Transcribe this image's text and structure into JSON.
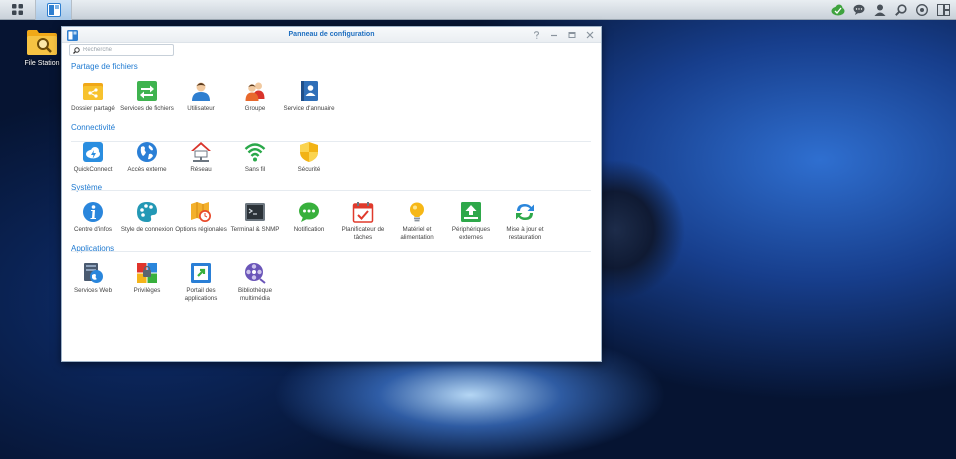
{
  "desktop": {
    "shortcut_label": "File Station"
  },
  "window": {
    "title": "Panneau de configuration",
    "search_placeholder": "Recherche"
  },
  "sections": [
    {
      "title": "Partage de fichiers",
      "items": [
        {
          "label": "Dossier partagé",
          "icon": "shared-folder-icon"
        },
        {
          "label": "Services de fichiers",
          "icon": "file-services-icon"
        },
        {
          "label": "Utilisateur",
          "icon": "user-icon"
        },
        {
          "label": "Groupe",
          "icon": "group-icon"
        },
        {
          "label": "Service d'annuaire",
          "icon": "directory-service-icon"
        }
      ]
    },
    {
      "title": "Connectivité",
      "items": [
        {
          "label": "QuickConnect",
          "icon": "quickconnect-icon"
        },
        {
          "label": "Accès externe",
          "icon": "external-access-icon"
        },
        {
          "label": "Réseau",
          "icon": "network-icon"
        },
        {
          "label": "Sans fil",
          "icon": "wireless-icon"
        },
        {
          "label": "Sécurité",
          "icon": "security-icon"
        }
      ]
    },
    {
      "title": "Système",
      "items": [
        {
          "label": "Centre d'infos",
          "icon": "info-center-icon"
        },
        {
          "label": "Style de connexion",
          "icon": "login-style-icon"
        },
        {
          "label": "Options régionales",
          "icon": "regional-options-icon"
        },
        {
          "label": "Terminal & SNMP",
          "icon": "terminal-icon"
        },
        {
          "label": "Notification",
          "icon": "notification-icon"
        },
        {
          "label": "Planificateur de tâches",
          "icon": "task-scheduler-icon"
        },
        {
          "label": "Matériel et alimentation",
          "icon": "hardware-power-icon"
        },
        {
          "label": "Périphériques externes",
          "icon": "external-devices-icon"
        },
        {
          "label": "Mise à jour et restauration",
          "icon": "update-restore-icon"
        }
      ]
    },
    {
      "title": "Applications",
      "items": [
        {
          "label": "Services Web",
          "icon": "web-services-icon"
        },
        {
          "label": "Privilèges",
          "icon": "privileges-icon"
        },
        {
          "label": "Portail des applications",
          "icon": "application-portal-icon"
        },
        {
          "label": "Bibliothèque multimédia",
          "icon": "media-library-icon"
        }
      ]
    }
  ]
}
